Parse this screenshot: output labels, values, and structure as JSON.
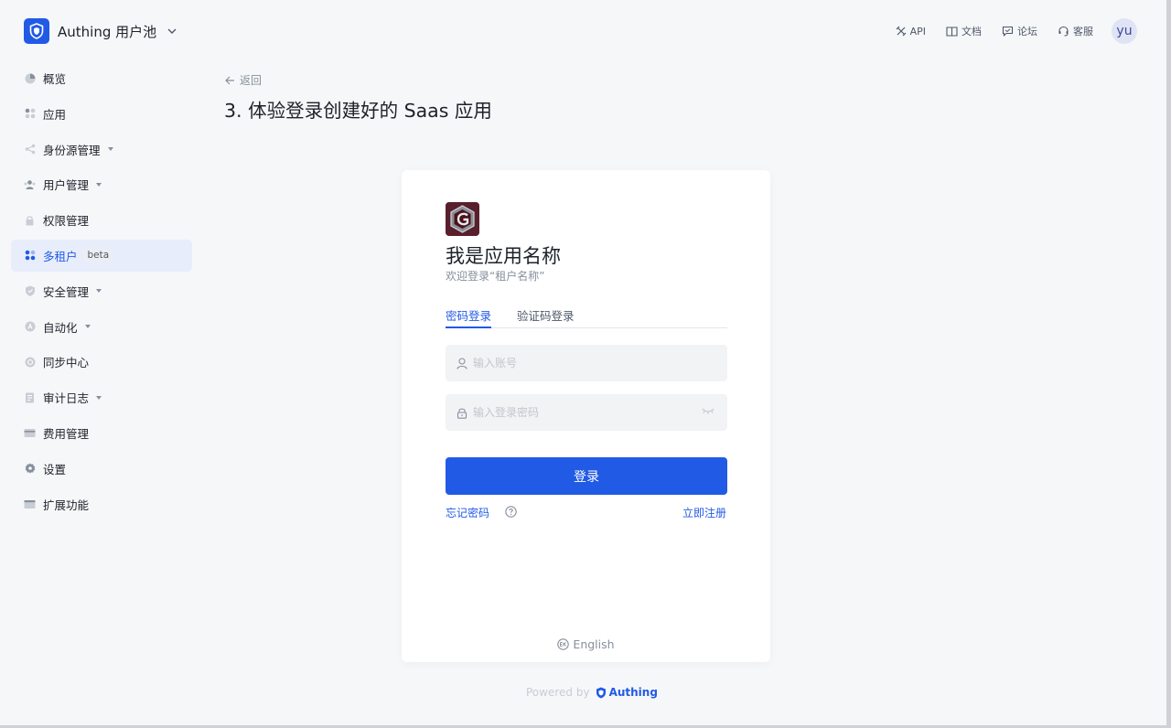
{
  "header": {
    "brand": "Authing 用户池",
    "links": {
      "api": "API",
      "docs": "文档",
      "forum": "论坛",
      "support": "客服"
    },
    "avatar_text": "yu"
  },
  "sidebar": {
    "items": [
      {
        "label": "概览"
      },
      {
        "label": "应用"
      },
      {
        "label": "身份源管理"
      },
      {
        "label": "用户管理"
      },
      {
        "label": "权限管理"
      },
      {
        "label": "多租户",
        "badge": "beta"
      },
      {
        "label": "安全管理"
      },
      {
        "label": "自动化"
      },
      {
        "label": "同步中心"
      },
      {
        "label": "审计日志"
      },
      {
        "label": "费用管理"
      },
      {
        "label": "设置"
      },
      {
        "label": "扩展功能"
      }
    ]
  },
  "main": {
    "back_label": "返回",
    "title": "3. 体验登录创建好的 Saas 应用"
  },
  "login": {
    "app_name": "我是应用名称",
    "welcome": "欢迎登录“租户名称”",
    "tabs": {
      "password": "密码登录",
      "code": "验证码登录"
    },
    "account_placeholder": "输入账号",
    "password_placeholder": "输入登录密码",
    "submit": "登录",
    "forgot": "忘记密码",
    "register": "立即注册",
    "language": "English"
  },
  "footer": {
    "powered_by": "Powered by",
    "brand": "Authing"
  },
  "colors": {
    "primary": "#215ae5",
    "sidebar_active_bg": "#e8edfb",
    "page_bg": "#f6f7f9"
  }
}
